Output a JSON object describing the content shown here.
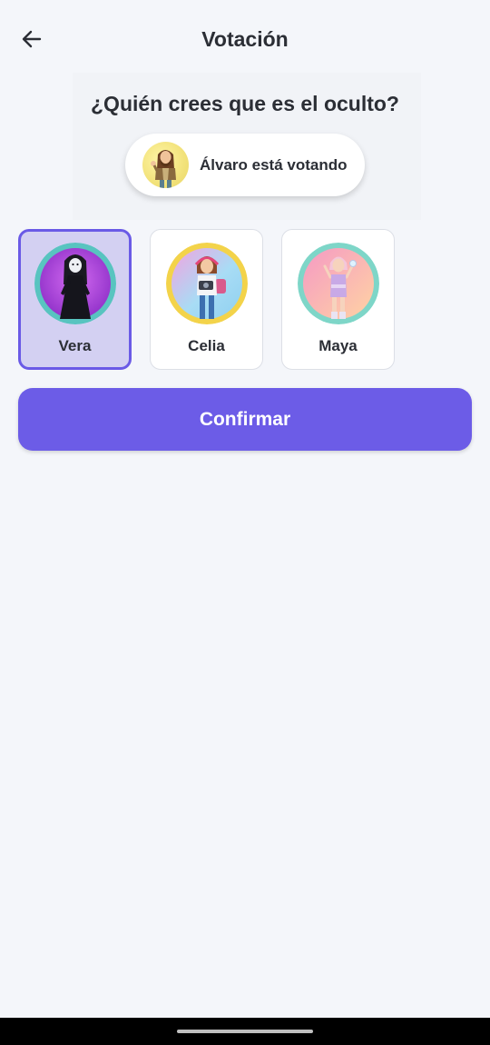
{
  "header": {
    "title": "Votación",
    "back_icon": "arrow-left-icon"
  },
  "prompt": {
    "question": "¿Quién crees que es el oculto?",
    "voter_status": "Álvaro está votando"
  },
  "candidates": [
    {
      "name": "Vera",
      "selected": true,
      "ring_color": "#58c4c0",
      "bg_color": "#a13fd6"
    },
    {
      "name": "Celia",
      "selected": false,
      "ring_color": "#f3d34a",
      "bg_color": "#9bd8f2"
    },
    {
      "name": "Maya",
      "selected": false,
      "ring_color": "#7ed6c8",
      "bg_color": "#f7a9c6"
    }
  ],
  "actions": {
    "confirm_label": "Confirmar"
  },
  "colors": {
    "accent": "#6c5ce7",
    "selected_card_bg": "#d3d0f2",
    "page_bg": "#f4f6fa"
  }
}
